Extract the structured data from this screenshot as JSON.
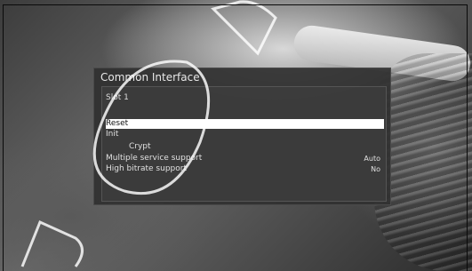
{
  "menu": {
    "title": "Common Interface",
    "slot_label": "Slot 1",
    "items": [
      {
        "label": "Reset",
        "value": "",
        "selected": true
      },
      {
        "label": "Init",
        "value": ""
      },
      {
        "label": "Crypt",
        "value": ""
      },
      {
        "label": "Multiple service support",
        "value": "Auto"
      },
      {
        "label": "High bitrate support",
        "value": "No"
      }
    ]
  },
  "colors": {
    "selection": "#ffffff",
    "panel": "#303030"
  }
}
